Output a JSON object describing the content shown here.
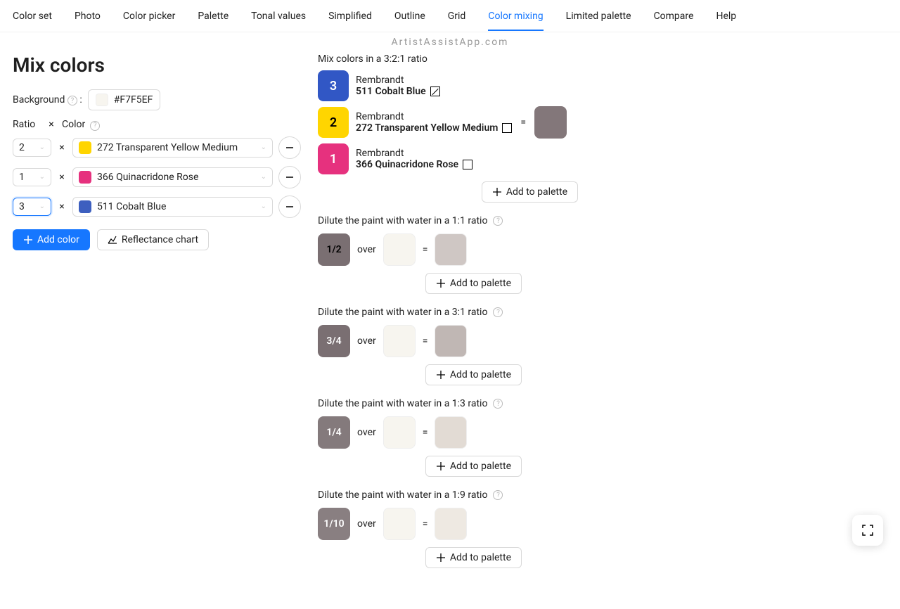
{
  "brand": "ArtistAssistApp.com",
  "tabs": [
    "Color set",
    "Photo",
    "Color picker",
    "Palette",
    "Tonal values",
    "Simplified",
    "Outline",
    "Grid",
    "Color mixing",
    "Limited palette",
    "Compare",
    "Help"
  ],
  "active_tab": "Color mixing",
  "page_title": "Mix colors",
  "background": {
    "label": "Background",
    "hex": "#F7F5EF"
  },
  "headers": {
    "ratio": "Ratio",
    "times": "×",
    "color": "Color"
  },
  "rows": [
    {
      "ratio": "2",
      "swatch": "#FFD500",
      "name": "272 Transparent Yellow Medium",
      "focused": false
    },
    {
      "ratio": "1",
      "swatch": "#E6317E",
      "name": "366 Quinacridone Rose",
      "focused": false
    },
    {
      "ratio": "3",
      "swatch": "#3D5FBF",
      "name": "511 Cobalt Blue",
      "focused": true
    }
  ],
  "buttons": {
    "add_color": "Add color",
    "reflectance": "Reflectance chart",
    "add_palette": "Add to palette"
  },
  "mix": {
    "title": "Mix colors in a 3:2:1 ratio",
    "items": [
      {
        "ratio": "3",
        "bg": "#3157C5",
        "fg": "#fff",
        "brand": "Rembrandt",
        "name": "511 Cobalt Blue",
        "icon": "diag"
      },
      {
        "ratio": "2",
        "bg": "#FFD500",
        "fg": "#000",
        "brand": "Rembrandt",
        "name": "272 Transparent Yellow Medium",
        "icon": "box"
      },
      {
        "ratio": "1",
        "bg": "#E6317E",
        "fg": "#fff",
        "brand": "Rembrandt",
        "name": "366 Quinacridone Rose",
        "icon": "box"
      }
    ],
    "equals": "=",
    "result": "#83777A"
  },
  "over": "over",
  "dilutions": [
    {
      "title": "Dilute the paint with water in a 1:1 ratio",
      "frac": "1/2",
      "frac_bg": "#7A6F72",
      "frac_fg": "#000",
      "bg": "#F7F5EF",
      "result": "#CFC7C4"
    },
    {
      "title": "Dilute the paint with water in a 3:1 ratio",
      "frac": "3/4",
      "frac_bg": "#7A6F72",
      "frac_fg": "#fff",
      "bg": "#F7F5EF",
      "result": "#C0B7B4"
    },
    {
      "title": "Dilute the paint with water in a 1:3 ratio",
      "frac": "1/4",
      "frac_bg": "#847A7C",
      "frac_fg": "#fff",
      "bg": "#F7F5EF",
      "result": "#E2DBD4"
    },
    {
      "title": "Dilute the paint with water in a 1:9 ratio",
      "frac": "1/10",
      "frac_bg": "#897F81",
      "frac_fg": "#fff",
      "bg": "#F7F5EF",
      "result": "#EEE9E2"
    }
  ]
}
